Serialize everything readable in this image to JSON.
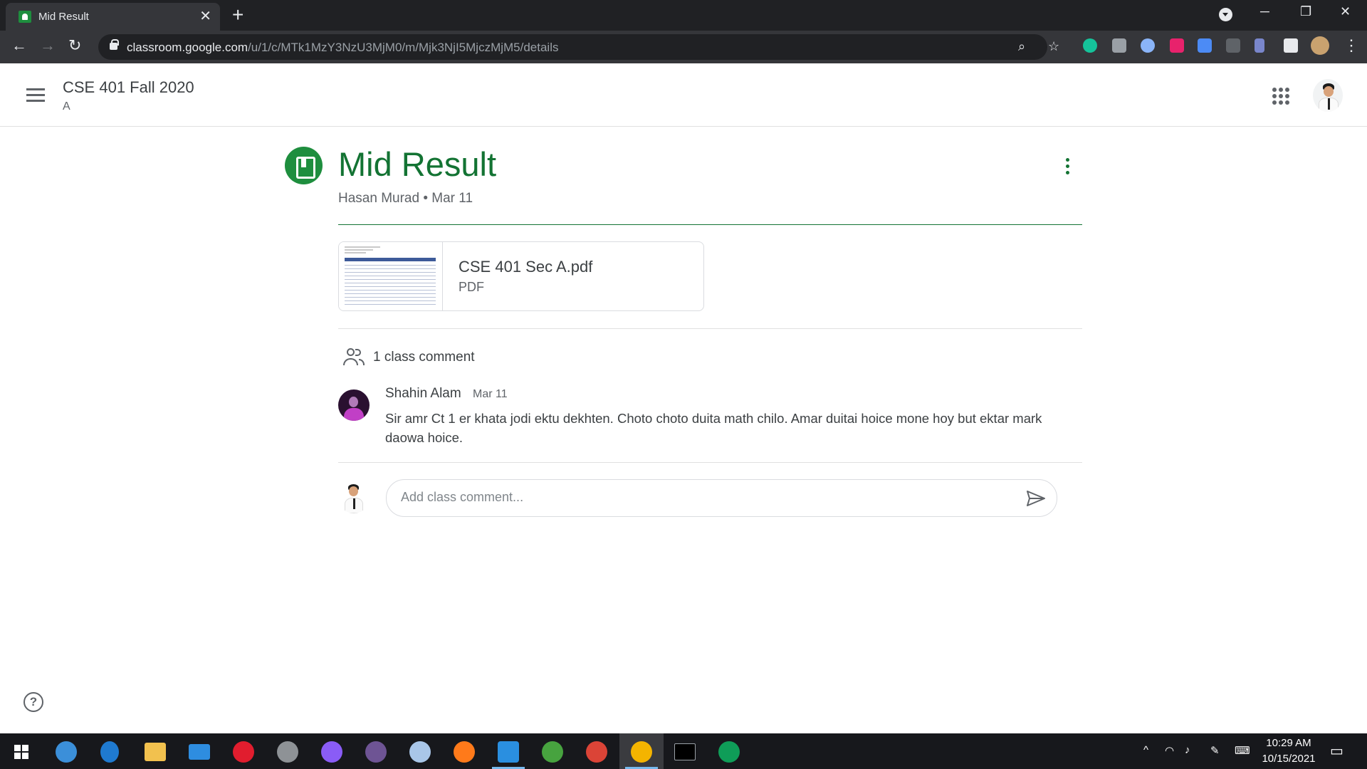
{
  "browser": {
    "tab_title": "Mid Result",
    "tab_close": "✕",
    "new_tab": "+",
    "url_host": "classroom.google.com",
    "url_path": "/u/1/c/MTk1MzY3NzU3MjM0/m/Mjk3NjI5MjczMjM5/details"
  },
  "header": {
    "class_name": "CSE 401 Fall 2020",
    "section": "A"
  },
  "post": {
    "title": "Mid Result",
    "author": "Hasan Murad",
    "separator": "•",
    "date": "Mar 11",
    "accent_color": "#137333"
  },
  "attachment": {
    "file_name": "CSE 401 Sec A.pdf",
    "file_type": "PDF"
  },
  "comments": {
    "count_label": "1 class comment",
    "items": [
      {
        "author": "Shahin Alam",
        "date": "Mar 11",
        "text": "Sir amr Ct 1 er khata jodi ektu dekhten. Choto choto duita math chilo. Amar duitai hoice mone hoy but ektar mark daowa hoice."
      }
    ],
    "input_placeholder": "Add class comment..."
  },
  "taskbar": {
    "time": "10:29 AM",
    "date": "10/15/2021"
  },
  "icons": [
    "menu-icon",
    "apps-grid-icon",
    "more-vert-icon",
    "assignment-icon",
    "people-icon",
    "send-icon",
    "help-icon"
  ]
}
